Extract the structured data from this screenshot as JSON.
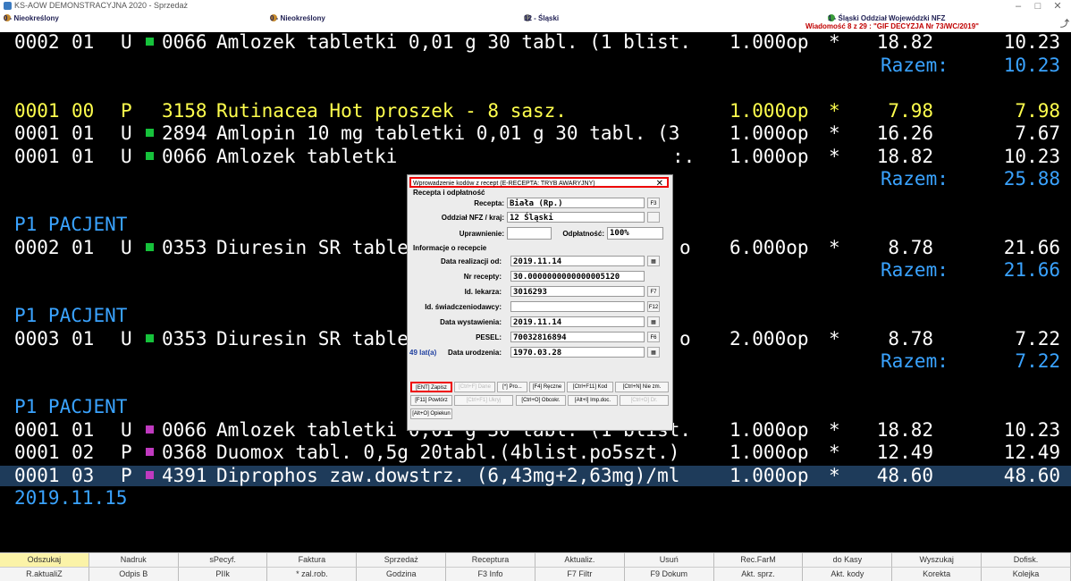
{
  "window": {
    "title": "KS-AOW DEMONSTRACYJNA 2020 - Sprzedaż"
  },
  "infobar": {
    "left": "0 - Nieokreślony",
    "middle": "0 - Nieokreślony",
    "center": "12 - Śląski",
    "right": "1 - Śląski Oddział Wojewódzki NFZ",
    "message": "Wiadomość 8 z 29 : \"GIF DECYZJA Nr 73/WC/2019\""
  },
  "rows": [
    {
      "t": "item",
      "c": "",
      "id": "0002",
      "n": "01",
      "k": "U",
      "m": "g",
      "code": "0066",
      "name": "Amlozek tabletki 0,01 g 30 tabl. (1 blist.",
      "qty": "1.000op",
      "star": "*",
      "price": "18.82",
      "val": "10.23"
    },
    {
      "t": "razem",
      "label": "Razem:",
      "val": "10.23"
    },
    {
      "t": "blank"
    },
    {
      "t": "item",
      "c": "yellow",
      "id": "0001",
      "n": "00",
      "k": "P",
      "m": "",
      "code": "3158",
      "name": "Rutinacea Hot proszek - 8 sasz.",
      "qty": "1.000op",
      "star": "*",
      "price": "7.98",
      "val": "7.98"
    },
    {
      "t": "item",
      "c": "",
      "id": "0001",
      "n": "01",
      "k": "U",
      "m": "g",
      "code": "2894",
      "name": "Amlopin 10 mg tabletki 0,01 g 30 tabl. (3",
      "qty": "1.000op",
      "star": "*",
      "price": "16.26",
      "val": "7.67"
    },
    {
      "t": "item",
      "c": "",
      "id": "0001",
      "n": "01",
      "k": "U",
      "m": "g",
      "code": "0066",
      "name": "Amlozek tabletki",
      "tail": ":.",
      "qty": "1.000op",
      "star": "*",
      "price": "18.82",
      "val": "10.23"
    },
    {
      "t": "razem",
      "label": "Razem:",
      "val": "25.88"
    },
    {
      "t": "blank"
    },
    {
      "t": "pac",
      "label": "P1 PACJENT"
    },
    {
      "t": "item",
      "c": "",
      "id": "0002",
      "n": "01",
      "k": "U",
      "m": "g",
      "code": "0353",
      "name": "Diuresin SR tablet",
      "tail": "o",
      "qty": "6.000op",
      "star": "*",
      "price": "8.78",
      "val": "21.66"
    },
    {
      "t": "razem",
      "label": "Razem:",
      "val": "21.66"
    },
    {
      "t": "blank"
    },
    {
      "t": "pac",
      "label": "P1 PACJENT"
    },
    {
      "t": "item",
      "c": "",
      "id": "0003",
      "n": "01",
      "k": "U",
      "m": "g",
      "code": "0353",
      "name": "Diuresin SR tablet",
      "tail": "o",
      "qty": "2.000op",
      "star": "*",
      "price": "8.78",
      "val": "7.22"
    },
    {
      "t": "razem",
      "label": "Razem:",
      "val": "7.22"
    },
    {
      "t": "blank"
    },
    {
      "t": "pac",
      "label": "P1 PACJENT"
    },
    {
      "t": "item",
      "c": "",
      "id": "0001",
      "n": "01",
      "k": "U",
      "m": "p",
      "code": "0066",
      "name": "Amlozek tabletki 0,01 g 30 tabl. (1 blist.",
      "qty": "1.000op",
      "star": "*",
      "price": "18.82",
      "val": "10.23"
    },
    {
      "t": "item",
      "c": "",
      "id": "0001",
      "n": "02",
      "k": "P",
      "m": "p",
      "code": "0368",
      "name": "Duomox tabl. 0,5g 20tabl.(4blist.po5szt.)",
      "qty": "1.000op",
      "star": "*",
      "price": "12.49",
      "val": "12.49"
    },
    {
      "t": "item",
      "c": "sel",
      "id": "0001",
      "n": "03",
      "k": "P",
      "m": "p",
      "code": "4391",
      "name": "Diprophos zaw.dowstrz. (6,43mg+2,63mg)/ml",
      "qty": "1.000op",
      "star": "*",
      "price": "48.60",
      "val": "48.60"
    },
    {
      "t": "date",
      "label": "2019.11.15"
    }
  ],
  "fkeys_row1": [
    "Odszukaj",
    "Nadruk",
    "sPecyf.",
    "Faktura",
    "Sprzedaż",
    "Receptura",
    "Aktualiz.",
    "Usuń",
    "Rec.FarM",
    "do Kasy",
    "Wyszukaj",
    "Dofisk."
  ],
  "fkeys_row2": [
    "R.aktualiZ",
    "Odpis B",
    "PIIk",
    "* zal.rob.",
    "Godzina",
    "F3 Info",
    "F7 Filtr",
    "F9 Dokum",
    "Akt. sprz.",
    "Akt. kody",
    "Korekta",
    "Kolejka"
  ],
  "dialog": {
    "title": "Wprowadzenie kodów z recept (E-RECEPTA: TRYB AWARYJNY)",
    "close": "✕",
    "sec1": "Recepta i odpłatność",
    "recepta_label": "Recepta:",
    "recepta_value": "Biała (Rp.)",
    "recepta_key": "F3",
    "oddzial_label": "Oddział NFZ / kraj:",
    "oddzial_value": "12 Śląski",
    "uprawnienie_label": "Uprawnienie:",
    "uprawnienie_value": "",
    "odplatnosc_label": "Odpłatność:",
    "odplatnosc_value": "100%",
    "sec2": "Informacje o recepcie",
    "realizacja_label": "Data realizacji od:",
    "realizacja_value": "2019.11.14",
    "nr_label": "Nr recepty:",
    "nr_value": "30.0000000000000005120",
    "lekarz_label": "Id. lekarza:",
    "lekarz_value": "3016293",
    "lekarz_key": "F7",
    "swiad_label": "Id. świadczeniodawcy:",
    "swiad_value": "",
    "swiad_key": "F12",
    "wystawienie_label": "Data wystawienia:",
    "wystawienie_value": "2019.11.14",
    "pesel_label": "PESEL:",
    "pesel_value": "70032816894",
    "pesel_key": "F6",
    "wiek": "49 lat(a)",
    "urodzenie_label": "Data urodzenia:",
    "urodzenie_value": "1970.03.28",
    "btn_zapisz": "[ENT] Zapisz",
    "btn_dis1": "[Ctrl+F] Dane",
    "btn_pro": "[*] Pro...",
    "btn_reczne": "[F4] Ręczne",
    "btn_kod": "[Ctrl+F11] Kod",
    "btn_niezm": "[Ctrl+N] Nie zm.",
    "btn_powtorz": "[F11] Powtórz",
    "btn_dis2": "[Ctrl+F1] Ukryj",
    "btn_obcokr": "[Ctrl+O] Obcokr.",
    "btn_impdoc": "[Alt+I] Imp.doc.",
    "btn_dis3": "[Ctrl+D] Dr.",
    "btn_opiekun": "[Alt+O] Opiekun"
  }
}
